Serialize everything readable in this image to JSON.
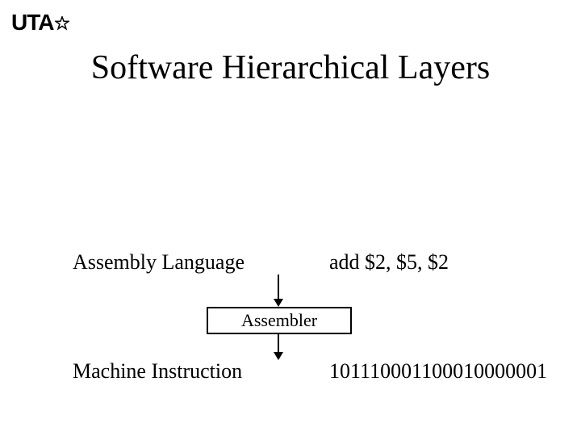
{
  "logo": {
    "text": "UTA"
  },
  "title": "Software Hierarchical Layers",
  "rows": {
    "assembly": {
      "label": "Assembly Language",
      "example": "add  $2, $5, $2"
    },
    "machine": {
      "label": "Machine Instruction",
      "example": "101110001100010000001"
    }
  },
  "assembler_box": "Assembler"
}
